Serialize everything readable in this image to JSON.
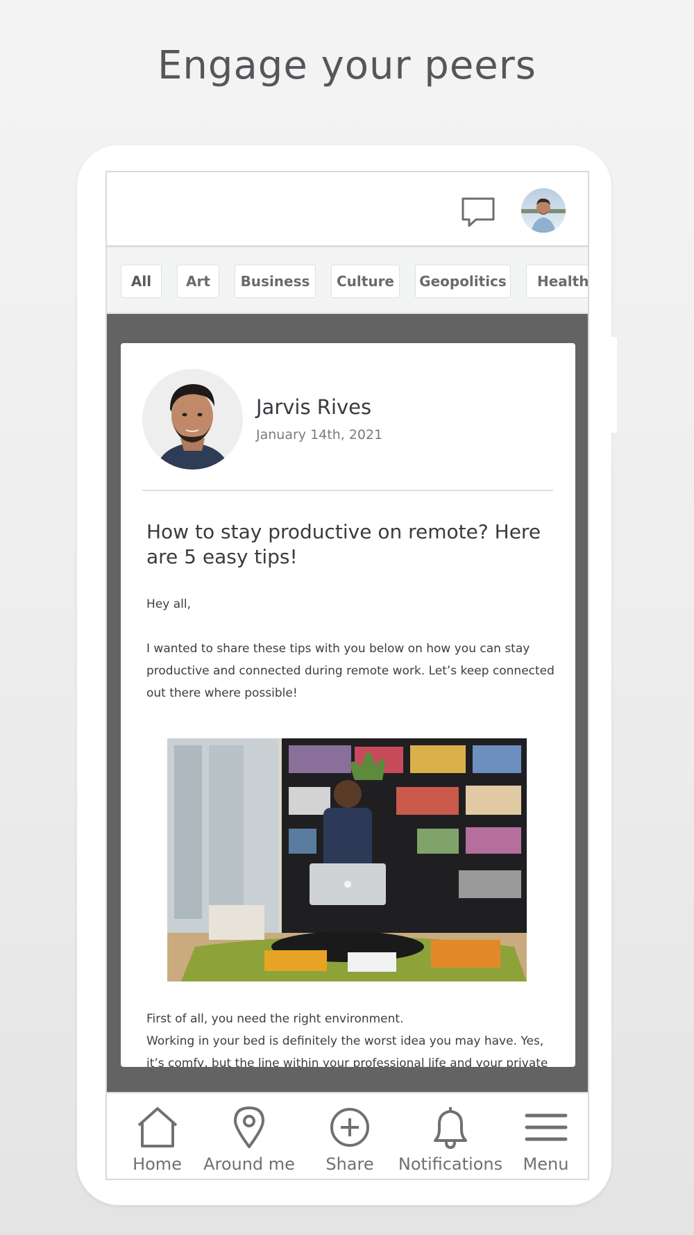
{
  "headline": "Engage your peers",
  "topbar": {
    "chat_icon": "chat-bubble-icon",
    "avatar": "user-avatar"
  },
  "categories": [
    "All",
    "Art",
    "Business",
    "Culture",
    "Geopolitics",
    "Health"
  ],
  "active_category": "All",
  "post": {
    "author": "Jarvis Rives",
    "date": "January 14th, 2021",
    "title": "How to stay productive on remote? Here are 5 easy tips!",
    "greeting": "Hey all,",
    "intro": "I wanted to share these tips with you below on how you can stay productive and connected during remote work. Let’s keep connected out there where possible!",
    "para1_line1": "First of all, you need the right environment.",
    "para1_line2": "Working in your bed is definitely the worst idea you may have. Yes, it’s comfy, but the line within your professional life and your private life will"
  },
  "tabs": [
    {
      "label": "Home",
      "icon": "home-icon"
    },
    {
      "label": "Around me",
      "icon": "location-pin-icon"
    },
    {
      "label": "Share",
      "icon": "plus-circle-icon"
    },
    {
      "label": "Notifications",
      "icon": "bell-icon"
    },
    {
      "label": "Menu",
      "icon": "hamburger-menu-icon"
    }
  ],
  "colors": {
    "icon_gray": "#707070",
    "text_dark": "#3a3a40",
    "frame_gray": "#636363"
  }
}
